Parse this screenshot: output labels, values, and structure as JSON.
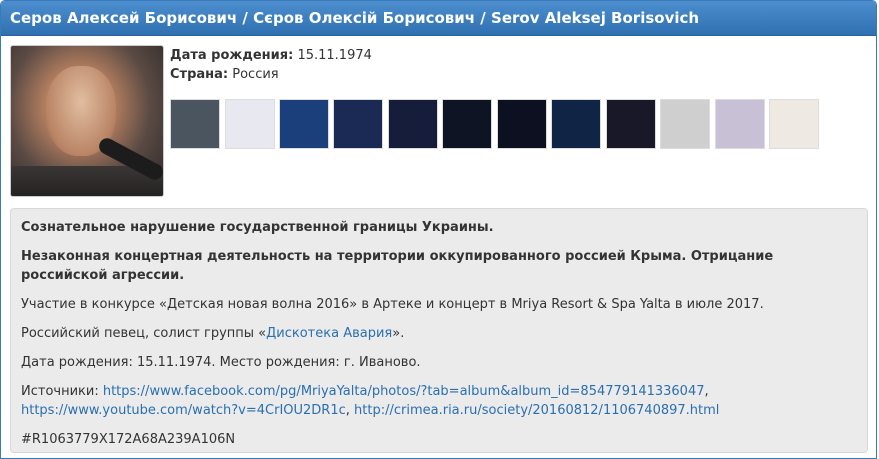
{
  "header": {
    "title": "Серов Алексей Борисович / Сєров Олексій Борисович / Serov Aleksej Borisovich"
  },
  "info": {
    "birth_label": "Дата рождения:",
    "birth_value": "15.11.1974",
    "country_label": "Страна:",
    "country_value": "Россия"
  },
  "thumbs": [
    {
      "bg": "#4a5560"
    },
    {
      "bg": "#e8e8f0"
    },
    {
      "bg": "#1b3f7a"
    },
    {
      "bg": "#1a2a55"
    },
    {
      "bg": "#151d3a"
    },
    {
      "bg": "#0f1425"
    },
    {
      "bg": "#0c1020"
    },
    {
      "bg": "#102445"
    },
    {
      "bg": "#181828"
    },
    {
      "bg": "#cfcfcf"
    },
    {
      "bg": "#c8c0d4"
    },
    {
      "bg": "#efe9e4"
    }
  ],
  "main": {
    "title1": "Сознательное нарушение государственной границы Украины.",
    "title2": "Незаконная концертная деятельность на территории оккупированного россией Крыма. Отрицание российской агрессии.",
    "p1": "Участие в конкурсе «Детская новая волна 2016» в Артеке и концерт в Mriya Resort & Spa Yalta в июле 2017.",
    "p2_pre": "Российский певец, солист группы «",
    "p2_link": "Дискотека Авария",
    "p2_post": "».",
    "p3": "Дата рождения: 15.11.1974. Место рождения: г. Иваново.",
    "sources_label": "Источники: ",
    "source1": "https://www.facebook.com/pg/MriyaYalta/photos/?tab=album&album_id=854779141336047",
    "comma1": ",",
    "source2": "https://www.youtube.com/watch?v=4CrIOU2DR1c",
    "comma2": ", ",
    "source3": "http://crimea.ria.ru/society/20160812/1106740897.html",
    "code": "#R1063779X172A68A239A106N"
  }
}
